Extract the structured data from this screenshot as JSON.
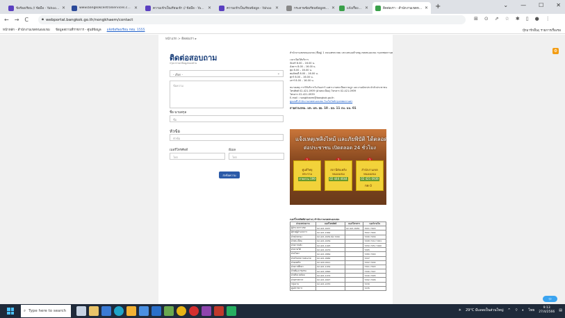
{
  "browser": {
    "tabs": [
      {
        "label": "ข้อร้องเรียน // ข้อมือ - Yahoo Search Results",
        "color": "#5a3fc0"
      },
      {
        "label": "www.bangkokcentralservices.com - Yahoo Search",
        "color": "#2b4a9a"
      },
      {
        "label": "ความเข้าเป็นเรียนเข้า // ข้อมือ - Yahoo Search",
        "color": "#5a3fc0"
      },
      {
        "label": "ความเข้าเป็นเรียนข้อมูล - Yahoo",
        "color": "#5a3fc0"
      },
      {
        "label": "กระดาษข้อเรียนข้อมูลจะเปลี่ยนแปลง",
        "color": "#888888"
      },
      {
        "label": "แจ้งเรื่องร้องเรียนและเสนอแนะ",
        "color": "#3aa04a"
      },
      {
        "label": "ติดต่อเรา - สำนักงานเขตหนองแขม",
        "color": "#3aa04a"
      }
    ],
    "new_tab": "+",
    "url": "webportal.bangkok.go.th/nongkhaem/contact",
    "bookmarks": [
      "หน้าหลัก - สำนักงานเขตหนองแขม",
      "ข้อมูลสถานที่ราชการ - ศูนย์ข้อมูล",
      "แจ้งข้อร้องเรียน กทม. 1555"
    ],
    "bookmarks_right": "บุ๊กมาร์กอื่นๆ   รายการเรื่องรอ"
  },
  "page": {
    "breadcrumb": "หน้าแรก > ติดต่อเรา ▸",
    "title": "ติดต่อสอบถาม",
    "subtitle": "กรุณากรอกข้อมูลของท่าน",
    "form": {
      "category_value": "- เลือก -",
      "message_placeholder": "ข้อความ",
      "name_label": "ชื่อ-นามสกุล",
      "name_placeholder": "ชื่อ",
      "subject_label": "หัวข้อ",
      "subject_placeholder": "หัวข้อ",
      "phone_label": "เบอร์โทรศัพท์",
      "phone_placeholder": "โทร",
      "email_label": "อีเมล",
      "email_placeholder": "โทร",
      "submit_label": "ส่งข้อความ"
    },
    "info_lines": [
      "สำนักงานเขตหนองแขม (ที่อยู่) 1 ถนนเพชรเกษม แขวงหนองค้างพลู เขตหนองแขม กรุงเทพมหานคร 10160",
      "",
      "เวลาเปิดให้บริการ",
      "จันทร์   8.00 – 16.00 น.",
      "อังคาร   8.00 – 16.00 น.",
      "พุธ   8.00 – 16.00 น.",
      "พฤหัสบดี   8.00 – 16.00 น.",
      "ศุกร์   8.00 – 16.00 น.",
      "เสาร์   8.00 – 16.00 น.",
      "",
      "หมายเหตุ การให้บริการในวันเสาร์ เฉพาะงานทะเบียนราษฎร และงานบัตรประจำตัวประชาชน",
      "โทรศัพท์ 02-421-0939 (ฝ่ายทะเบียน) โทรสาร 02-421-0939",
      "โทรสาร 02-421-0939",
      "E-mail : nongkhaem@bangkok.go.th"
    ],
    "info_link": "ดูแผนที่ สำนักงานเขตหนองแขม ในเว็บไซต์กรุงเทพมหานคร",
    "info_bold": "สายด่วนกทม.    มท. มท. ยย. 10 . ยย. 11 ภม. มม. 01",
    "banner": {
      "title": "แจ้งเหตุเพลิงไหม้ และภัยพิบัติ ได้ตลอด",
      "subtitle": "ต่อประชาชน เปิดตลอด 24 ชั่วโมง",
      "cards": [
        {
          "line1": "ศูนย์วิทยุ",
          "line2": "พระราม",
          "line3": "สายด่วน 199"
        },
        {
          "line1": "สถานีดับเพลิง",
          "line2": "หนองแขม",
          "line3": "02 444 4644"
        },
        {
          "line1": "สำนักงานเขต",
          "line2": "หนองแขม",
          "line3": "02 421 0939"
        }
      ],
      "footer": "กด 0"
    },
    "table_title": "เบอร์โทรศัพท์ฝ่ายต่างๆ สำนักงานเขตหนองแขม",
    "table": {
      "headers": [
        "ฝ่าย/หน่วยงาน",
        "เบอร์โทรศัพท์",
        "เบอร์โทรสาร",
        "เบอร์ภายใน"
      ],
      "rows": [
        [
          "ผู้อำนวยการเขต",
          "02-421-0937",
          "02-421-0939",
          "7001 7003"
        ],
        [
          "ผู้ช่วยผู้อำนวยการ",
          "02-421-1664",
          "",
          "7002 7004"
        ],
        [
          "ฝ่ายปกครอง",
          "02-421-0939 ต่อ 7209",
          "",
          "7206 7209"
        ],
        [
          "ฝ่ายทะเบียน",
          "02-421-0939",
          "",
          "7208 7212 7261"
        ],
        [
          "ฝ่ายการคลัง",
          "02-421-1025",
          "",
          "7250 7251 7260"
        ],
        [
          "ฝ่ายรายได้",
          "02-421-0479",
          "",
          "7265"
        ],
        [
          "ฝ่ายโยธา",
          "02-421-0869",
          "",
          "7289 7290"
        ],
        [
          "ฝ่ายรักษาความสะอาด",
          "02-421-0682",
          "",
          "7247"
        ],
        [
          "ฝ่ายเทศกิจ",
          "02-420-4611",
          "",
          "7202 7204"
        ],
        [
          "ฝ่ายการศึกษา",
          "02-421-1932",
          "",
          "7301 7303"
        ],
        [
          "ฝ่ายพัฒนาชุมชน",
          "02-421-4890",
          "",
          "7306 7307"
        ],
        [
          "ฝ่ายสิ่งแวดล้อม",
          "02-421-1074",
          "",
          "7240 7295"
        ],
        [
          "ฝ่ายสรรพากร",
          "02-421-0927",
          "",
          "7292 7296"
        ],
        [
          "กลุ่มงาน",
          "02-421-2253",
          "",
          "7230"
        ],
        [
          "ศูนย์ราชการ",
          "",
          "",
          "7235"
        ]
      ]
    }
  },
  "taskbar": {
    "search_placeholder": "Type here to search",
    "weather": "29°C มีแดดเป็นส่วนใหญ่",
    "time": "9:13",
    "date": "27/4/2566"
  }
}
